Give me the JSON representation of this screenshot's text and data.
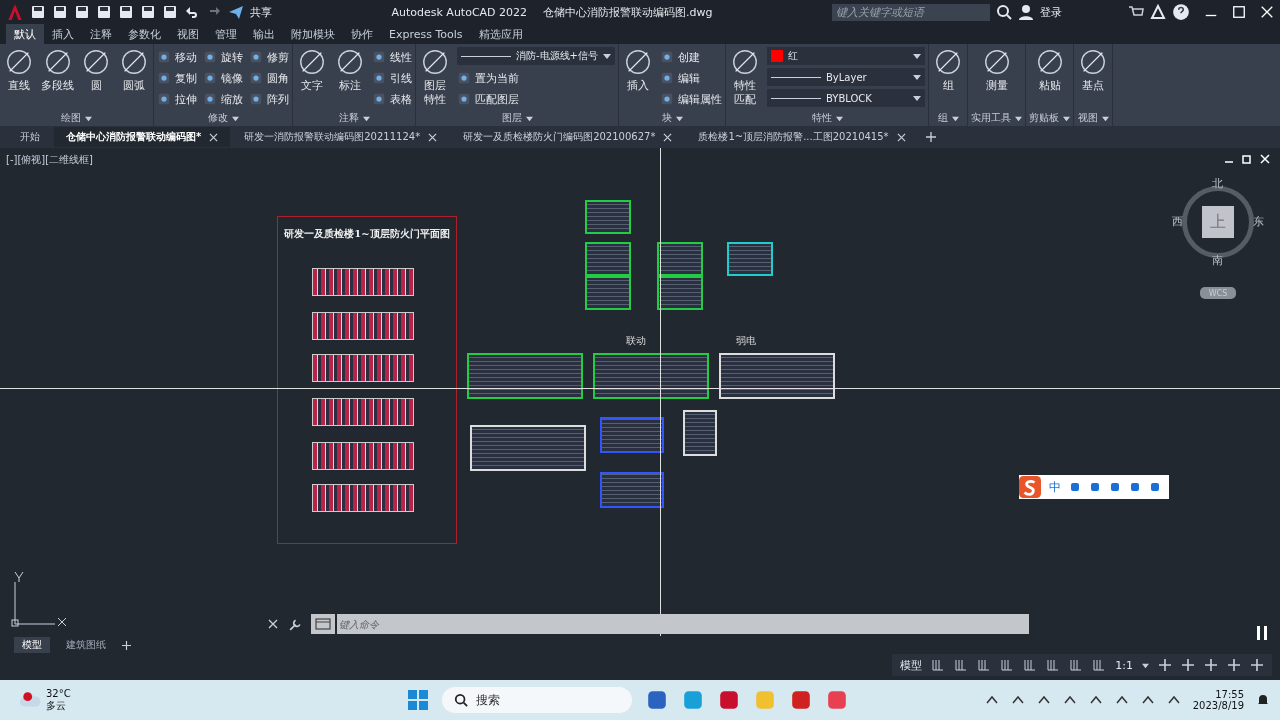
{
  "title_bar": {
    "share": "共享",
    "app_title": "Autodesk AutoCAD 2022",
    "file_name": "仓储中心消防报警联动编码图.dwg",
    "search": {
      "placeholder": "键入关键字或短语"
    },
    "login": "登录"
  },
  "ribbon_tabs": [
    {
      "label": "默认",
      "selected": true
    },
    {
      "label": "插入",
      "selected": false
    },
    {
      "label": "注释",
      "selected": false
    },
    {
      "label": "参数化",
      "selected": false
    },
    {
      "label": "视图",
      "selected": false
    },
    {
      "label": "管理",
      "selected": false
    },
    {
      "label": "输出",
      "selected": false
    },
    {
      "label": "附加模块",
      "selected": false
    },
    {
      "label": "协作",
      "selected": false
    },
    {
      "label": "Express Tools",
      "selected": false
    },
    {
      "label": "精选应用",
      "selected": false
    }
  ],
  "ribbon_panels": [
    {
      "title": "绘图",
      "tools": [
        {
          "kind": "large",
          "label": "直线"
        },
        {
          "kind": "large",
          "label": "多段线"
        },
        {
          "kind": "large",
          "label": "圆"
        },
        {
          "kind": "large",
          "label": "圆弧"
        }
      ]
    },
    {
      "title": "修改",
      "tools": [
        {
          "kind": "small",
          "label": "移动"
        },
        {
          "kind": "small",
          "label": "复制"
        },
        {
          "kind": "small",
          "label": "拉伸"
        },
        {
          "kind": "small",
          "label": "旋转"
        },
        {
          "kind": "small",
          "label": "镜像"
        },
        {
          "kind": "small",
          "label": "缩放"
        },
        {
          "kind": "small",
          "label": "修剪"
        },
        {
          "kind": "small",
          "label": "圆角"
        },
        {
          "kind": "small",
          "label": "阵列"
        }
      ]
    },
    {
      "title": "注释",
      "tools": [
        {
          "kind": "large",
          "label": "文字"
        },
        {
          "kind": "large",
          "label": "标注"
        },
        {
          "kind": "small",
          "label": "线性"
        },
        {
          "kind": "small",
          "label": "引线"
        },
        {
          "kind": "small",
          "label": "表格"
        }
      ]
    },
    {
      "title": "图层",
      "tools": [
        {
          "kind": "large2",
          "label": "图层特性"
        },
        {
          "kind": "dropdown",
          "label": "消防-电源线+信号"
        },
        {
          "kind": "small",
          "label": "置为当前"
        },
        {
          "kind": "small",
          "label": "匹配图层"
        }
      ]
    },
    {
      "title": "块",
      "tools": [
        {
          "kind": "large",
          "label": "插入"
        },
        {
          "kind": "small",
          "label": "创建"
        },
        {
          "kind": "small",
          "label": "编辑"
        },
        {
          "kind": "small",
          "label": "编辑属性"
        }
      ]
    },
    {
      "title": "特性",
      "tools": [
        {
          "kind": "large2",
          "label": "特性匹配"
        },
        {
          "kind": "dropdown",
          "label": "红",
          "color": "#ff0000"
        },
        {
          "kind": "dropdown",
          "label": "ByLayer"
        },
        {
          "kind": "dropdown",
          "label": "BYBLOCK"
        }
      ]
    },
    {
      "title": "组",
      "tools": [
        {
          "kind": "large",
          "label": "组"
        }
      ]
    },
    {
      "title": "实用工具",
      "tools": [
        {
          "kind": "large",
          "label": "测量"
        }
      ]
    },
    {
      "title": "剪贴板",
      "tools": [
        {
          "kind": "large",
          "label": "粘贴"
        }
      ]
    },
    {
      "title": "视图",
      "tools": [
        {
          "kind": "large",
          "label": "基点"
        }
      ]
    }
  ],
  "file_tabs": [
    {
      "label": "开始",
      "selected": false,
      "closable": false
    },
    {
      "label": "仓储中心消防报警联动编码图*",
      "selected": true,
      "closable": true
    },
    {
      "label": "研发一消防报警联动编码图20211124*",
      "selected": false,
      "closable": true
    },
    {
      "label": "研发一及质检楼防火门编码图202100627*",
      "selected": false,
      "closable": true
    },
    {
      "label": "质检楼1~顶层消防报警...工图20210415*",
      "selected": false,
      "closable": true
    }
  ],
  "viewport_label": "[-][俯视][二维线框]",
  "canvas": {
    "title": "研发一及质检楼1~顶层防火门平面图",
    "labels": [
      "联动",
      "弱电"
    ]
  },
  "viewcube": {
    "north": "北",
    "south": "南",
    "east": "东",
    "west": "西",
    "face": "上",
    "ucs": "WCS"
  },
  "command_line": {
    "placeholder": "键入命令"
  },
  "layout_tabs": [
    {
      "label": "模型",
      "selected": true
    },
    {
      "label": "建筑图纸",
      "selected": false
    }
  ],
  "status_bar": {
    "mode": "模型",
    "scale": "1:1"
  },
  "ime_bar": {
    "mode": "中"
  },
  "taskbar": {
    "temperature": "32°C",
    "weather": "多云",
    "search": {
      "placeholder": "搜索"
    },
    "time": "17:55",
    "date": "2023/8/19"
  }
}
